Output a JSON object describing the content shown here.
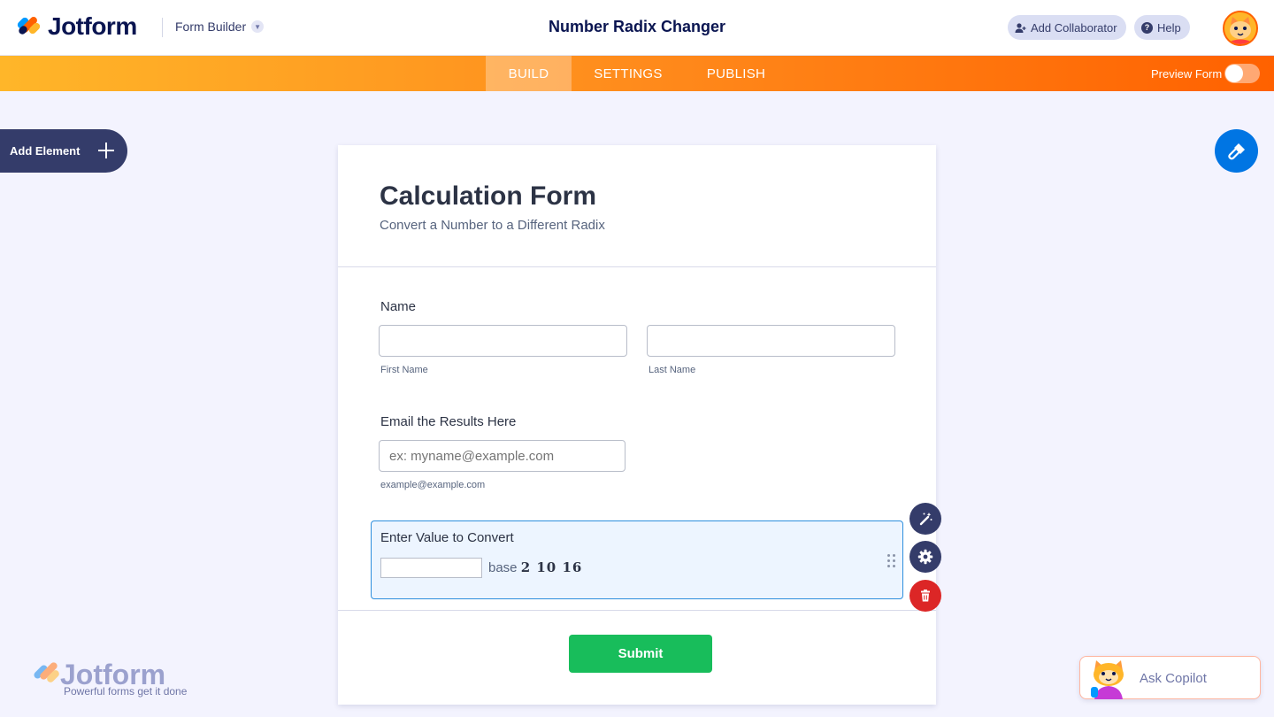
{
  "header": {
    "logo_text": "Jotform",
    "builder_label": "Form Builder",
    "form_name": "Number Radix Changer",
    "add_collaborator_label": "Add Collaborator",
    "help_label": "Help"
  },
  "nav": {
    "tabs": [
      {
        "label": "BUILD",
        "active": true
      },
      {
        "label": "SETTINGS",
        "active": false
      },
      {
        "label": "PUBLISH",
        "active": false
      }
    ],
    "preview_label": "Preview Form",
    "preview_enabled": false
  },
  "sidebar": {
    "add_element_label": "Add Element"
  },
  "form": {
    "title": "Calculation Form",
    "subtitle": "Convert a Number to a Different Radix",
    "name_field": {
      "label": "Name",
      "first_sublabel": "First Name",
      "last_sublabel": "Last Name",
      "first_value": "",
      "last_value": ""
    },
    "email_field": {
      "label": "Email the Results Here",
      "placeholder": "ex: myname@example.com",
      "sublabel": "example@example.com"
    },
    "radix_field": {
      "label": "Enter Value to Convert",
      "value": "",
      "base_prefix": "base",
      "bases": "2 10 16"
    },
    "submit_label": "Submit"
  },
  "watermark": {
    "brand": "Jotform",
    "tagline": "Powerful forms get it done"
  },
  "copilot": {
    "label": "Ask Copilot"
  },
  "colors": {
    "brand_navy": "#0a1551",
    "nav_orange_start": "#ffb629",
    "nav_orange_end": "#ff6100",
    "submit_green": "#18bd5b",
    "designer_blue": "#0075e3",
    "active_field_border": "#2e8fdd",
    "delete_red": "#dc2626"
  },
  "icons": {
    "logo": "jotform-logo-icon",
    "dropdown": "chevron-down-icon",
    "collaborator": "add-user-icon",
    "help": "help-icon",
    "avatar": "cat-avatar-icon",
    "add_element": "plus-icon",
    "designer": "paint-roller-icon",
    "wand": "magic-wand-icon",
    "settings": "gear-icon",
    "delete": "trash-icon",
    "drag": "drag-handle-icon"
  }
}
